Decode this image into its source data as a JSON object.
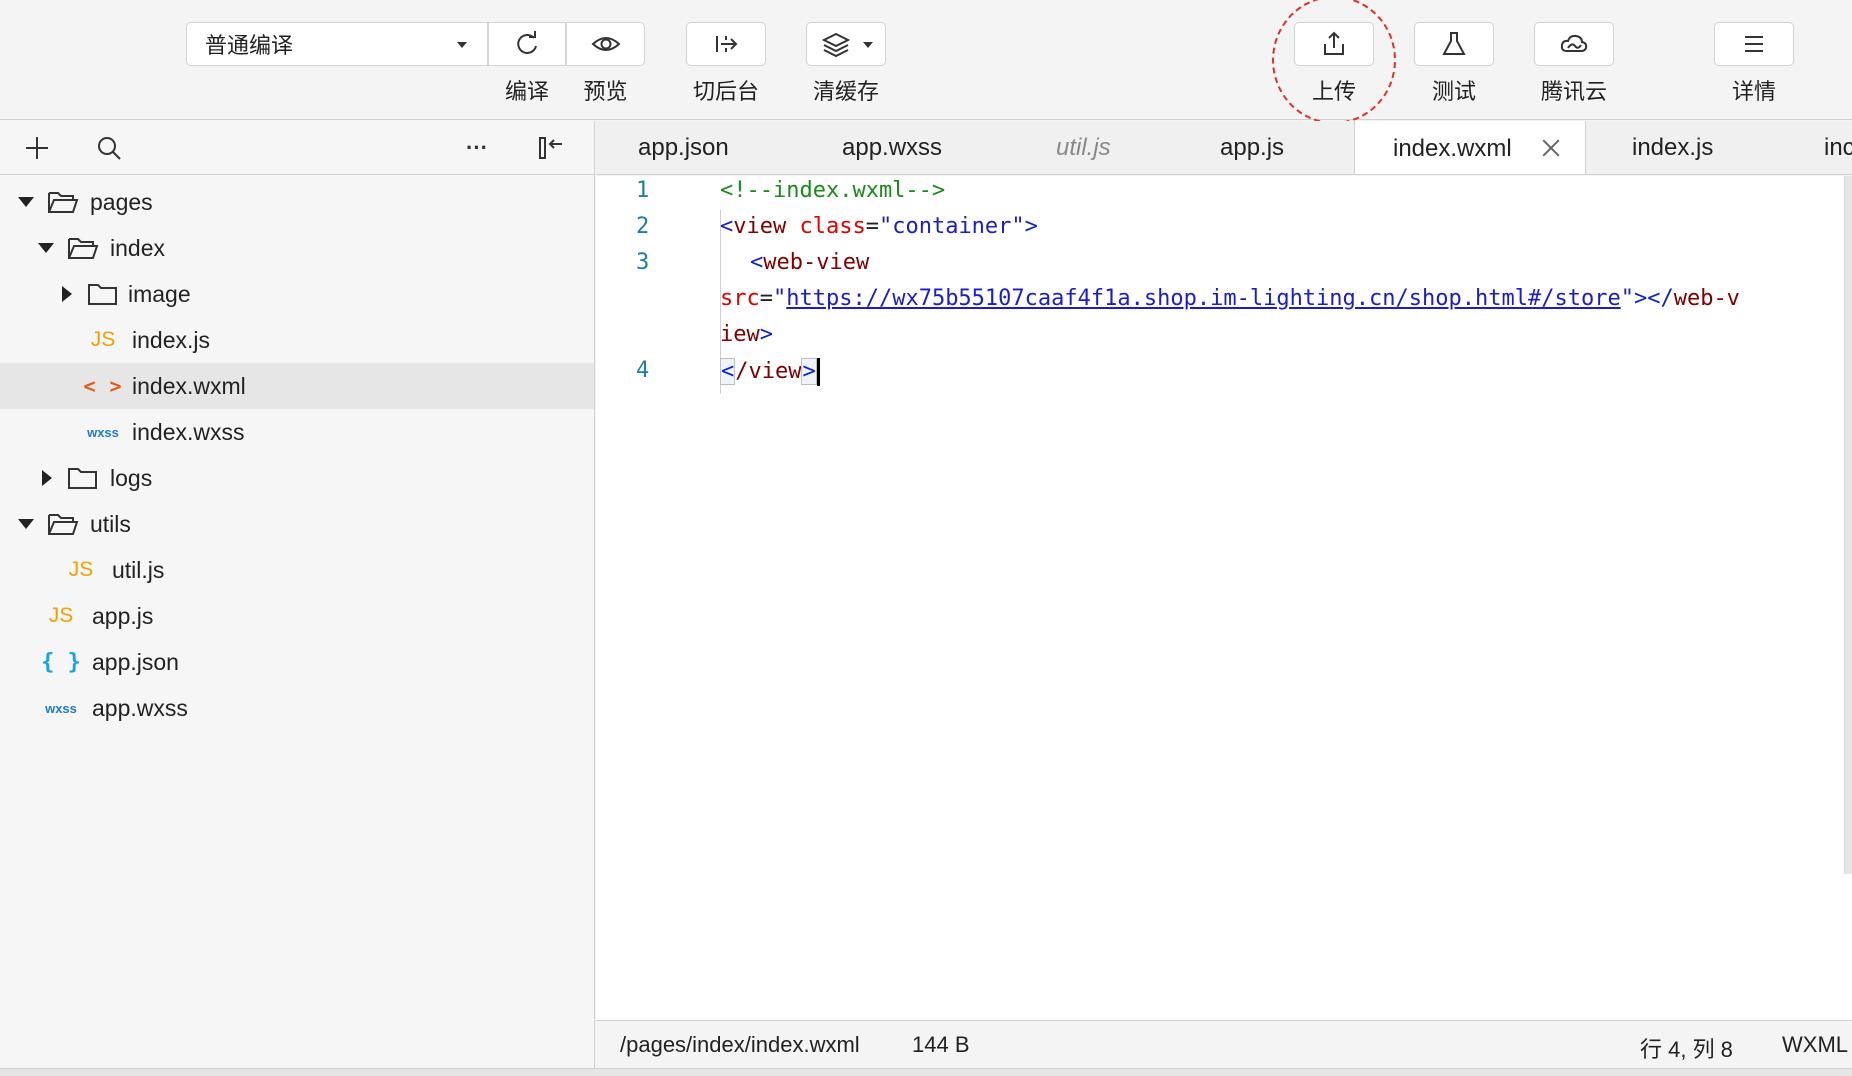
{
  "toolbar": {
    "compile_mode": "普通编译",
    "buttons": {
      "compile": "编译",
      "preview": "预览",
      "background": "切后台",
      "clear_cache": "清缓存",
      "upload": "上传",
      "test": "测试",
      "tencent_cloud": "腾讯云",
      "details": "详情"
    },
    "icons": {
      "compile": "refresh-icon",
      "preview": "eye-icon",
      "background": "switch-background-icon",
      "clear_cache": "layers-icon",
      "upload": "upload-icon",
      "test": "flask-icon",
      "tencent_cloud": "cloud-icon",
      "details": "menu-lines-icon"
    },
    "highlight_color": "#e0302a"
  },
  "sidebar": {
    "tree": [
      {
        "label": "pages",
        "type": "folder",
        "expanded": true,
        "depth": 0
      },
      {
        "label": "index",
        "type": "folder",
        "expanded": true,
        "depth": 1
      },
      {
        "label": "image",
        "type": "folder",
        "expanded": false,
        "depth": 2
      },
      {
        "label": "index.js",
        "type": "js",
        "badge": "JS",
        "depth": 2
      },
      {
        "label": "index.wxml",
        "type": "wxml",
        "badge": "< >",
        "depth": 2,
        "selected": true
      },
      {
        "label": "index.wxss",
        "type": "wxss",
        "badge": "wxss",
        "depth": 2
      },
      {
        "label": "logs",
        "type": "folder",
        "expanded": false,
        "depth": 1
      },
      {
        "label": "utils",
        "type": "folder",
        "expanded": true,
        "depth": 0
      },
      {
        "label": "util.js",
        "type": "js",
        "badge": "JS",
        "depth": 1
      },
      {
        "label": "app.js",
        "type": "js",
        "badge": "JS",
        "depth": 0
      },
      {
        "label": "app.json",
        "type": "json",
        "badge": "{ }",
        "depth": 0
      },
      {
        "label": "app.wxss",
        "type": "wxss",
        "badge": "wxss",
        "depth": 0
      }
    ],
    "tool_icons": [
      "plus-icon",
      "search-icon",
      "more-icon",
      "collapse-panel-icon"
    ],
    "more_label": "···"
  },
  "tabs": [
    {
      "label": "app.json"
    },
    {
      "label": "app.wxss"
    },
    {
      "label": "util.js",
      "preview": true
    },
    {
      "label": "app.js"
    },
    {
      "label": "index.wxml",
      "active": true
    },
    {
      "label": "index.js"
    },
    {
      "label": "inc"
    }
  ],
  "editor": {
    "line_numbers": [
      "1",
      "2",
      "3",
      "4"
    ],
    "code": {
      "l1_comment": "<!--index.wxml-->",
      "l2_open": "<",
      "l2_tag": "view",
      "l2_attr": " class",
      "l2_eq": "=",
      "l2_val": "\"container\"",
      "l2_close": ">",
      "l3_open": "<",
      "l3_tag": "web-view",
      "l3b_attr": "src",
      "l3b_eq": "=",
      "l3b_q1": "\"",
      "l3b_url": "https://wx75b55107caaf4f1a.shop.im-lighting.cn/shop.html#/store",
      "l3b_q2": "\"",
      "l3b_close": "></",
      "l3b_tag": "web-v",
      "l3c_tag": "iew",
      "l3c_close": ">",
      "l4_open": "<",
      "l4_tag": "/view",
      "l4_close": ">"
    }
  },
  "statusbar": {
    "path": "/pages/index/index.wxml",
    "size": "144 B",
    "position": "行 4, 列 8",
    "language": "WXML"
  }
}
